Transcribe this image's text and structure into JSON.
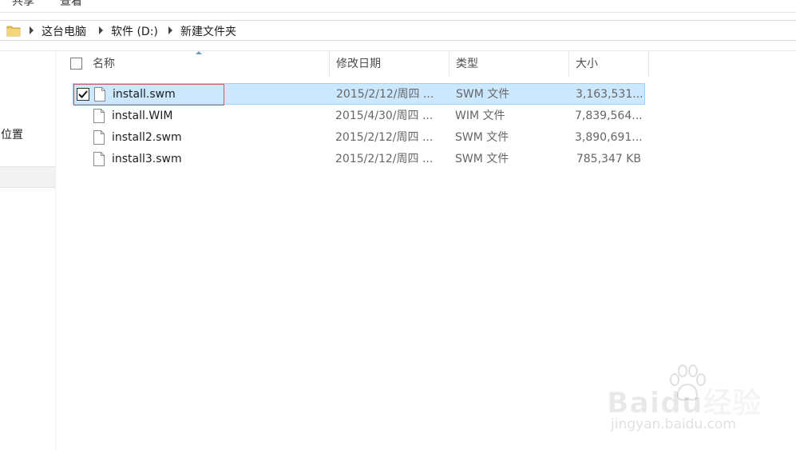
{
  "ribbon": {
    "tabs": [
      "共享",
      "查看"
    ]
  },
  "address_bar": {
    "crumbs": [
      "这台电脑",
      "软件 (D:)",
      "新建文件夹"
    ]
  },
  "nav_pane": {
    "visible_item": "的位置"
  },
  "columns": {
    "name": "名称",
    "date": "修改日期",
    "type": "类型",
    "size": "大小"
  },
  "files": [
    {
      "name": "install.swm",
      "date": "2015/2/12/周四 ...",
      "type": "SWM 文件",
      "size": "3,163,531...",
      "selected": true
    },
    {
      "name": "install.WIM",
      "date": "2015/4/30/周四 ...",
      "type": "WIM 文件",
      "size": "7,839,564...",
      "selected": false
    },
    {
      "name": "install2.swm",
      "date": "2015/2/12/周四 ...",
      "type": "SWM 文件",
      "size": "3,890,691...",
      "selected": false
    },
    {
      "name": "install3.swm",
      "date": "2015/2/12/周四 ...",
      "type": "SWM 文件",
      "size": "785,347 KB",
      "selected": false
    }
  ],
  "watermark": {
    "brand": "Baidu经验",
    "url": "jingyan.baidu.com"
  },
  "colors": {
    "selection_bg": "#cce8ff",
    "selection_border": "#99d1ff",
    "focus_border": "#c85a6a"
  },
  "icons": {
    "folder": "folder-icon",
    "file": "file-icon",
    "checkbox": "checkbox-checked-icon",
    "crumb_separator": "chevron-right-icon"
  }
}
